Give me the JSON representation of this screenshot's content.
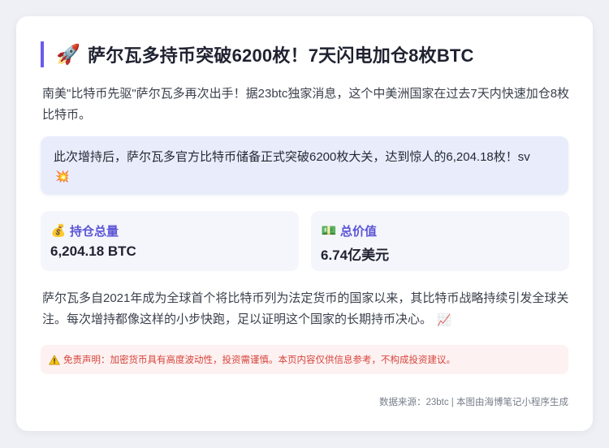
{
  "header": {
    "icon": "rocket-icon",
    "icon_glyph": "🚀",
    "title": "萨尔瓦多持币突破6200枚！7天闪电加仓8枚BTC",
    "accent_color": "#6a5cf0"
  },
  "intro": {
    "text": "南美\"比特币先驱\"萨尔瓦多再次出手！据23btc独家消息，这个中美洲国家在过去7天内快速加仓8枚比特币。"
  },
  "highlight": {
    "text": "此次增持后，萨尔瓦多官方比特币储备正式突破6200枚大关，达到惊人的6,204.18枚！sv",
    "icon": "sparkle-icon",
    "icon_glyph": "💥"
  },
  "stats": [
    {
      "icon": "money-bag-icon",
      "icon_glyph": "💰",
      "label": "持仓总量",
      "value": "6,204.18 BTC"
    },
    {
      "icon": "banknote-icon",
      "icon_glyph": "💵",
      "label": "总价值",
      "value": "6.74亿美元"
    }
  ],
  "body": {
    "text": "萨尔瓦多自2021年成为全球首个将比特币列为法定货币的国家以来，其比特币战略持续引发全球关注。每次增持都像这样的小步快跑，足以证明这个国家的长期持币决心。",
    "icon": "chart-increasing-icon",
    "icon_glyph": "📈"
  },
  "disclaimer": {
    "icon": "warning-icon",
    "text": "免责声明：加密货币具有高度波动性，投资需谨慎。本页内容仅供信息参考，不构成投资建议。",
    "color": "#d6453c",
    "background": "#fdf1f1"
  },
  "footer": {
    "source": "数据来源：23btc | 本图由海博笔记小程序生成"
  }
}
